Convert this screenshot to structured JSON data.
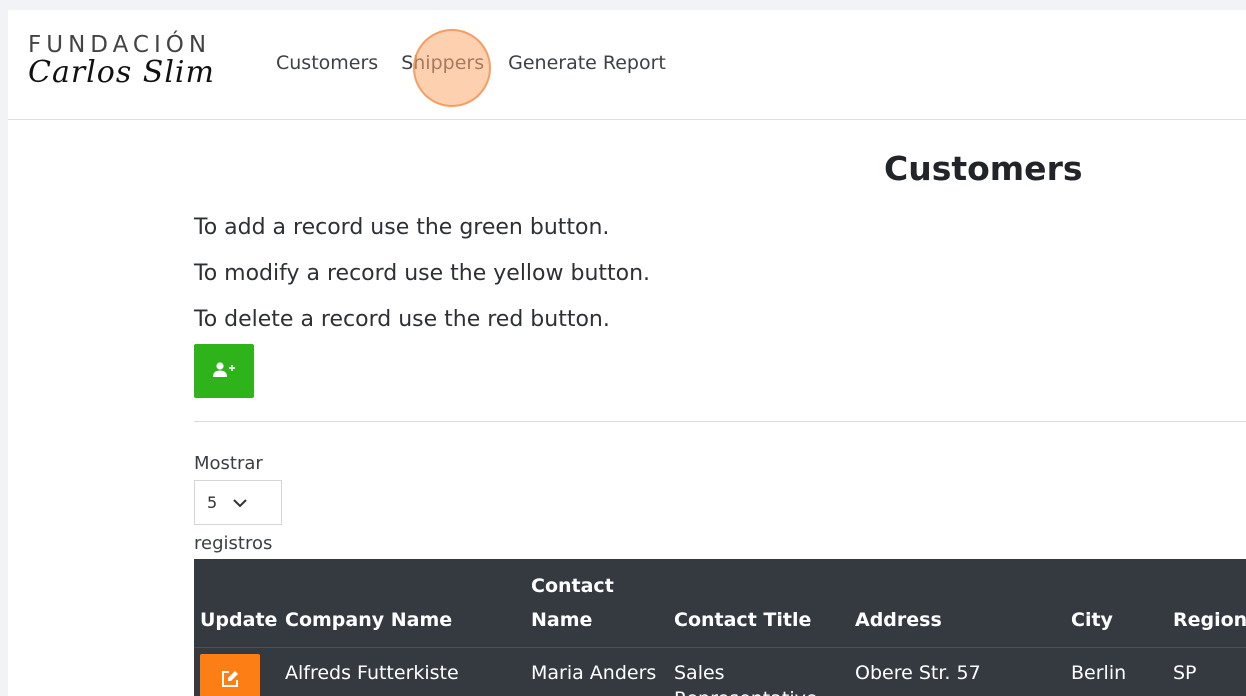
{
  "logo": {
    "line1": "FUNDACIÓN",
    "line2": "Carlos Slim"
  },
  "nav": {
    "items": [
      {
        "label": "Customers"
      },
      {
        "label": "Shippers"
      },
      {
        "label": "Generate Report"
      }
    ]
  },
  "page": {
    "title": "Customers",
    "instructions": [
      "To add a record use the green button.",
      "To modify a record use the yellow button.",
      "To delete a record use the red button."
    ],
    "add_button_icon": "user-plus-icon"
  },
  "pagination": {
    "label_before": "Mostrar",
    "selected": "5",
    "label_after": "registros"
  },
  "table": {
    "headers": [
      "Update",
      "Company Name",
      "Contact Name",
      "Contact Title",
      "Address",
      "City",
      "Region"
    ],
    "rows": [
      {
        "company": "Alfreds Futterkiste",
        "contact": "Maria Anders",
        "title": "Sales Representative",
        "address": "Obere Str. 57",
        "city": "Berlin",
        "region": "SP"
      }
    ]
  },
  "colors": {
    "add_button": "#2fb31a",
    "edit_button": "#fd7e14",
    "table_header": "#343a40",
    "click_marker": "#fba970"
  }
}
